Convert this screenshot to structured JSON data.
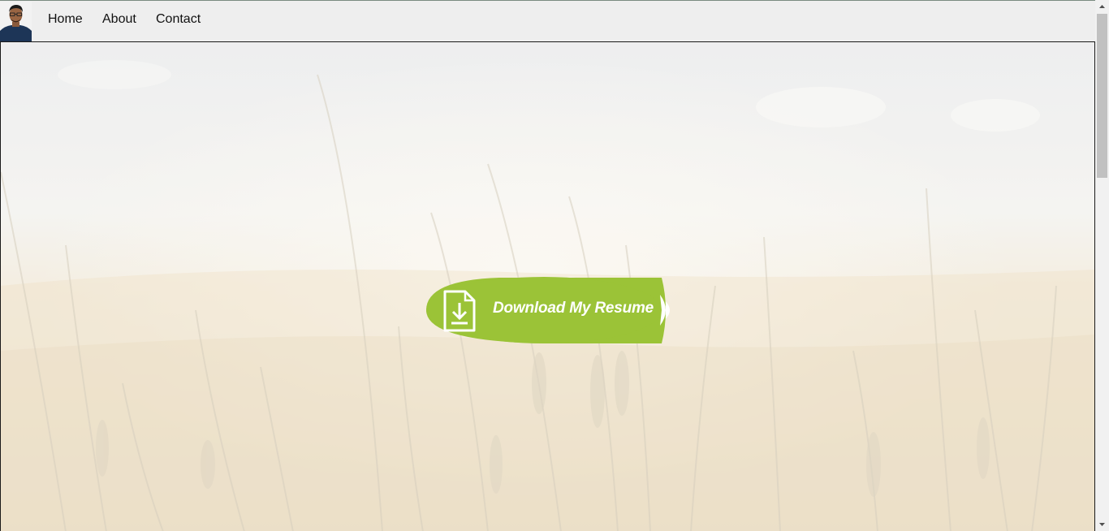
{
  "nav": {
    "items": [
      {
        "label": "Home"
      },
      {
        "label": "About"
      },
      {
        "label": "Contact"
      }
    ]
  },
  "hero": {
    "download_label": "Download My Resume",
    "download_icon": "file-download-icon",
    "accent_color": "#9bc337"
  },
  "scrollbar": {
    "thumb_color": "#c1c1c1"
  }
}
